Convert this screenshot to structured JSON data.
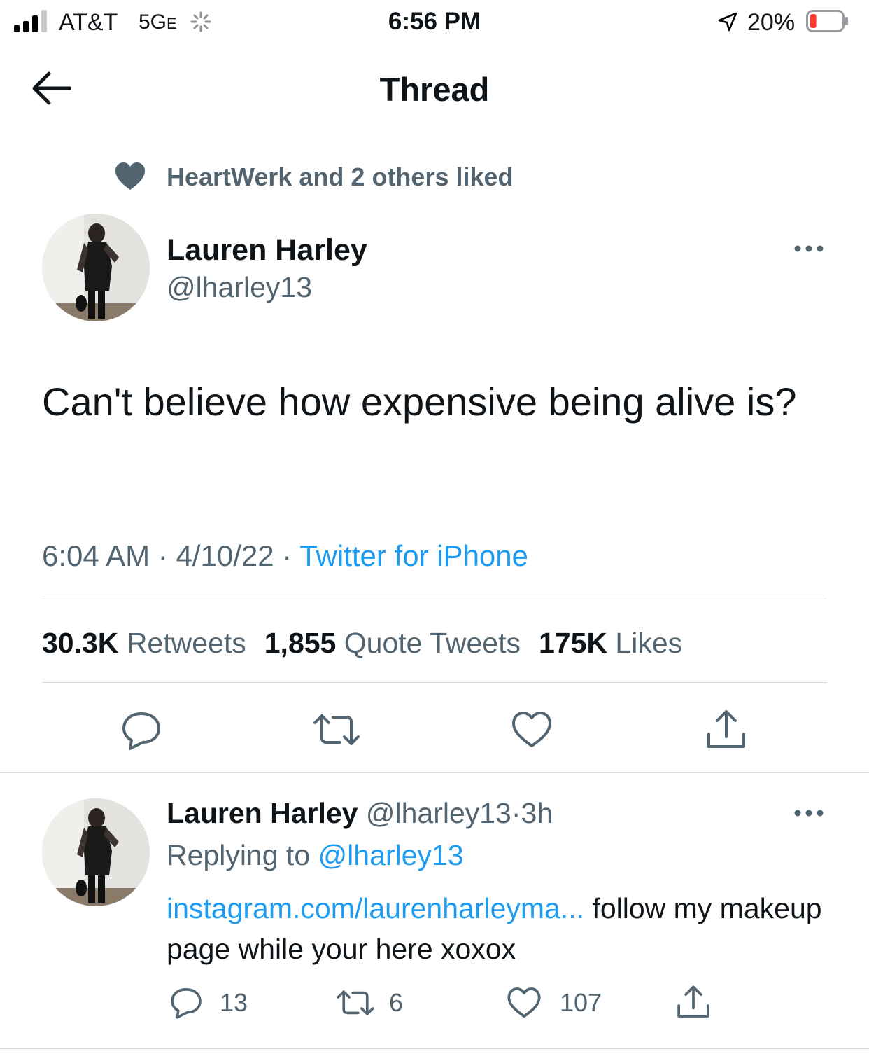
{
  "status_bar": {
    "carrier": "AT&T",
    "network": "5G",
    "network_suffix": "E",
    "time": "6:56 PM",
    "battery": "20%",
    "battery_fill_fraction": 0.2,
    "battery_color": "#ff3b30"
  },
  "header": {
    "title": "Thread"
  },
  "social_context": {
    "text": "HeartWerk and 2 others liked"
  },
  "main_tweet": {
    "author_name": "Lauren Harley",
    "handle": "@lharley13",
    "text": "Can't believe how expensive being alive is?",
    "time": "6:04 AM",
    "date": "4/10/22",
    "separator": "·",
    "source": "Twitter for iPhone",
    "stats": {
      "retweets_count": "30.3K",
      "retweets_label": "Retweets",
      "quotes_count": "1,855",
      "quotes_label": "Quote Tweets",
      "likes_count": "175K",
      "likes_label": "Likes"
    }
  },
  "reply_tweet": {
    "author_name": "Lauren Harley",
    "handle": "@lharley13",
    "age": "3h",
    "separator": "·",
    "replying_prefix": "Replying to",
    "replying_handle": "@lharley13",
    "link_text": "instagram.com/laurenharleyma...",
    "text_after_link": " follow my makeup page while your here xoxox",
    "reply_count": "13",
    "retweet_count": "6",
    "like_count": "107"
  },
  "colors": {
    "text_primary": "#0f1419",
    "text_secondary": "#536471",
    "link_blue": "#1d9bf0",
    "divider": "#d5dbe0"
  },
  "icons": [
    "back-arrow-icon",
    "heart-filled-icon",
    "more-icon",
    "reply-icon",
    "retweet-icon",
    "like-icon",
    "share-icon",
    "location-arrow-icon",
    "battery-icon",
    "signal-icon"
  ]
}
